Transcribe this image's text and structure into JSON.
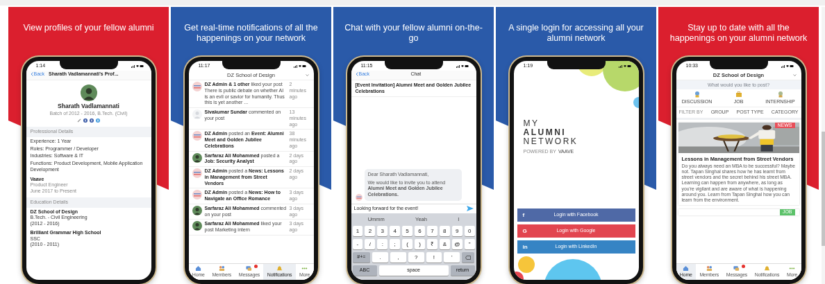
{
  "panels": [
    {
      "kind": "profile",
      "color": "#db1f2e",
      "caption": "View profiles of your fellow alumni",
      "phone": {
        "time": "1:14",
        "back": "Back",
        "title": "Sharath Vadlamannati's Prof...",
        "name": "Sharath Vadlamannati",
        "batch": "Batch of 2012 - 2016, B.Tech. (Civil)",
        "professional_heading": "Professional Details",
        "details": [
          "Experience: 1 Year",
          "Roles: Programmer / Developer",
          "Industries: Software & IT",
          "Functions: Product Development, Mobile Application Development"
        ],
        "work": {
          "company": "Vaave",
          "role": "Product Engineer",
          "period": "June 2017 to Present"
        },
        "education_heading": "Education Details",
        "education": [
          {
            "school": "DZ School of Design",
            "degree": "B.Tech. - Civil Engineering",
            "years": "(2012 - 2016)"
          },
          {
            "school": "Brilliant Grammar High School",
            "degree": "SSC",
            "years": "(2010 - 2011)"
          }
        ]
      }
    },
    {
      "kind": "notifications",
      "color": "#2a5aa9",
      "caption": "Get real-time notifications of all the happenings on your network",
      "phone": {
        "time": "11:17",
        "header": "DZ School of Design",
        "items": [
          {
            "kind": "logo",
            "text": "**DZ Admin & 1 other** liked your post There is public debate on whether AI is an evil or savior for humanity. Thus this is yet another ...",
            "time": "2 minutes ago"
          },
          {
            "kind": "blank",
            "text": "**Sivakumar Sundar** commented on your post",
            "time": "13 minutes ago"
          },
          {
            "kind": "logo",
            "text": "**DZ Admin** posted an **Event: Alumni Meet and Golden Jubilee Celebrations**",
            "time": "38 minutes ago"
          },
          {
            "text": "**Sarfaraz Ali Mohammed** posted a **Job: Security Analyst**",
            "time": "2 days ago"
          },
          {
            "kind": "logo",
            "text": "**DZ Admin** posted a **News: Lessons in Management from Street Vendors**",
            "time": "2 days ago"
          },
          {
            "kind": "logo",
            "text": "**DZ Admin** posted a **News: How to Navigate an Office Romance**",
            "time": "3 days ago"
          },
          {
            "text": "**Sarfaraz Ali Mohammed** commented on your post",
            "time": "3 days ago"
          },
          {
            "text": "**Sarfaraz Ali Mohammed** liked your post Marketing intern",
            "time": "3 days ago"
          }
        ],
        "tabs": [
          {
            "kind": "home",
            "label": "Home",
            "selected": false,
            "alert": false
          },
          {
            "kind": "members",
            "label": "Members",
            "selected": false,
            "alert": false
          },
          {
            "kind": "messages",
            "label": "Messages",
            "selected": false,
            "alert": true
          },
          {
            "kind": "notifications",
            "label": "Notifications",
            "selected": true,
            "alert": false
          },
          {
            "kind": "more",
            "label": "More",
            "selected": false,
            "alert": false
          }
        ]
      }
    },
    {
      "kind": "chat",
      "color": "#2a5aa9",
      "caption": "Chat with your fellow alumni on-the-go",
      "phone": {
        "time": "11:15",
        "back": "Back",
        "title": "Chat",
        "subject": "[Event Invitation] Alumni Meet and Golden Jubilee Celebrations",
        "message": [
          "Dear Sharath Vadlamannati,",
          "We would like to invite you to attend **Alumni Meet and Golden Jubilee Celebrations.**"
        ],
        "input": "Looking forward for the event!",
        "suggestions": [
          "Ummm",
          "Yeah",
          "I"
        ],
        "keys": [
          [
            {
              "kind": "char",
              "label": "1"
            },
            {
              "kind": "char",
              "label": "2"
            },
            {
              "kind": "char",
              "label": "3"
            },
            {
              "kind": "char",
              "label": "4"
            },
            {
              "kind": "char",
              "label": "5"
            },
            {
              "kind": "char",
              "label": "6"
            },
            {
              "kind": "char",
              "label": "7"
            },
            {
              "kind": "char",
              "label": "8"
            },
            {
              "kind": "char",
              "label": "9"
            },
            {
              "kind": "char",
              "label": "0"
            }
          ],
          [
            {
              "kind": "char",
              "label": "-"
            },
            {
              "kind": "char",
              "label": "/"
            },
            {
              "kind": "char",
              "label": ":"
            },
            {
              "kind": "char",
              "label": ";"
            },
            {
              "kind": "char",
              "label": "("
            },
            {
              "kind": "char",
              "label": ")"
            },
            {
              "kind": "char",
              "label": "₹"
            },
            {
              "kind": "char",
              "label": "&"
            },
            {
              "kind": "char",
              "label": "@"
            },
            {
              "kind": "char",
              "label": "\""
            }
          ],
          [
            {
              "kind": "mod",
              "label": "#+="
            },
            {
              "kind": "wide",
              "label": "."
            },
            {
              "kind": "wide",
              "label": ","
            },
            {
              "kind": "wide",
              "label": "?"
            },
            {
              "kind": "wide",
              "label": "!"
            },
            {
              "kind": "wide",
              "label": "'"
            },
            {
              "kind": "delete"
            }
          ],
          [
            {
              "kind": "mod",
              "label": "ABC"
            },
            {
              "kind": "space",
              "label": "space"
            },
            {
              "kind": "mod",
              "label": "return"
            }
          ]
        ]
      }
    },
    {
      "kind": "login",
      "color": "#2a5aa9",
      "caption": "A single login for accessing all your alumni network",
      "phone": {
        "time": "1:19",
        "logo": [
          "MY",
          "ALUMNI",
          "NETWORK"
        ],
        "powered_by": "POWERED BY",
        "brand": "VAAVE",
        "buttons": [
          {
            "icon": "f",
            "label": "Login with Facebook",
            "color": "#4f69a6"
          },
          {
            "icon": "G",
            "label": "Login with Google",
            "color": "#e2454f"
          },
          {
            "icon": "in",
            "label": "Login with LinkedIn",
            "color": "#3684c4"
          }
        ]
      }
    },
    {
      "kind": "feed",
      "color": "#db1f2e",
      "caption": "Stay up to date with all the happenings on your  alumni network",
      "phone": {
        "time": "10:33",
        "header": "DZ School of Design",
        "placeholder": "What would you like to post?",
        "post_types": [
          {
            "kind": "discussion",
            "label": "DISCUSSION"
          },
          {
            "kind": "job",
            "label": "JOB"
          },
          {
            "kind": "internship",
            "label": "INTERNSHIP"
          }
        ],
        "filter_label": "FILTER BY",
        "filters": [
          "GROUP",
          "POST TYPE",
          "CATEGORY"
        ],
        "post": {
          "tag": "NEWS",
          "title": "Lessons in Management from Street Vendors",
          "body": "Do you always need an MBA to be successful? Maybe not. Tapan Singhal shares how he has learnt from street vendors and the secret behind his street MBA. Learning can happen from anywhere, as long as you're vigilant and are aware of what is happening around you. Learn from Tapan Singhal how you can learn from the environment."
        },
        "next_tag": "JOB",
        "tabs": [
          {
            "kind": "home",
            "label": "Home",
            "selected": true,
            "alert": false
          },
          {
            "kind": "members",
            "label": "Members",
            "selected": false,
            "alert": false
          },
          {
            "kind": "messages",
            "label": "Messages",
            "selected": false,
            "alert": true
          },
          {
            "kind": "notifications",
            "label": "Notifications",
            "selected": false,
            "alert": false
          },
          {
            "kind": "more",
            "label": "More",
            "selected": false,
            "alert": false
          }
        ]
      }
    }
  ]
}
